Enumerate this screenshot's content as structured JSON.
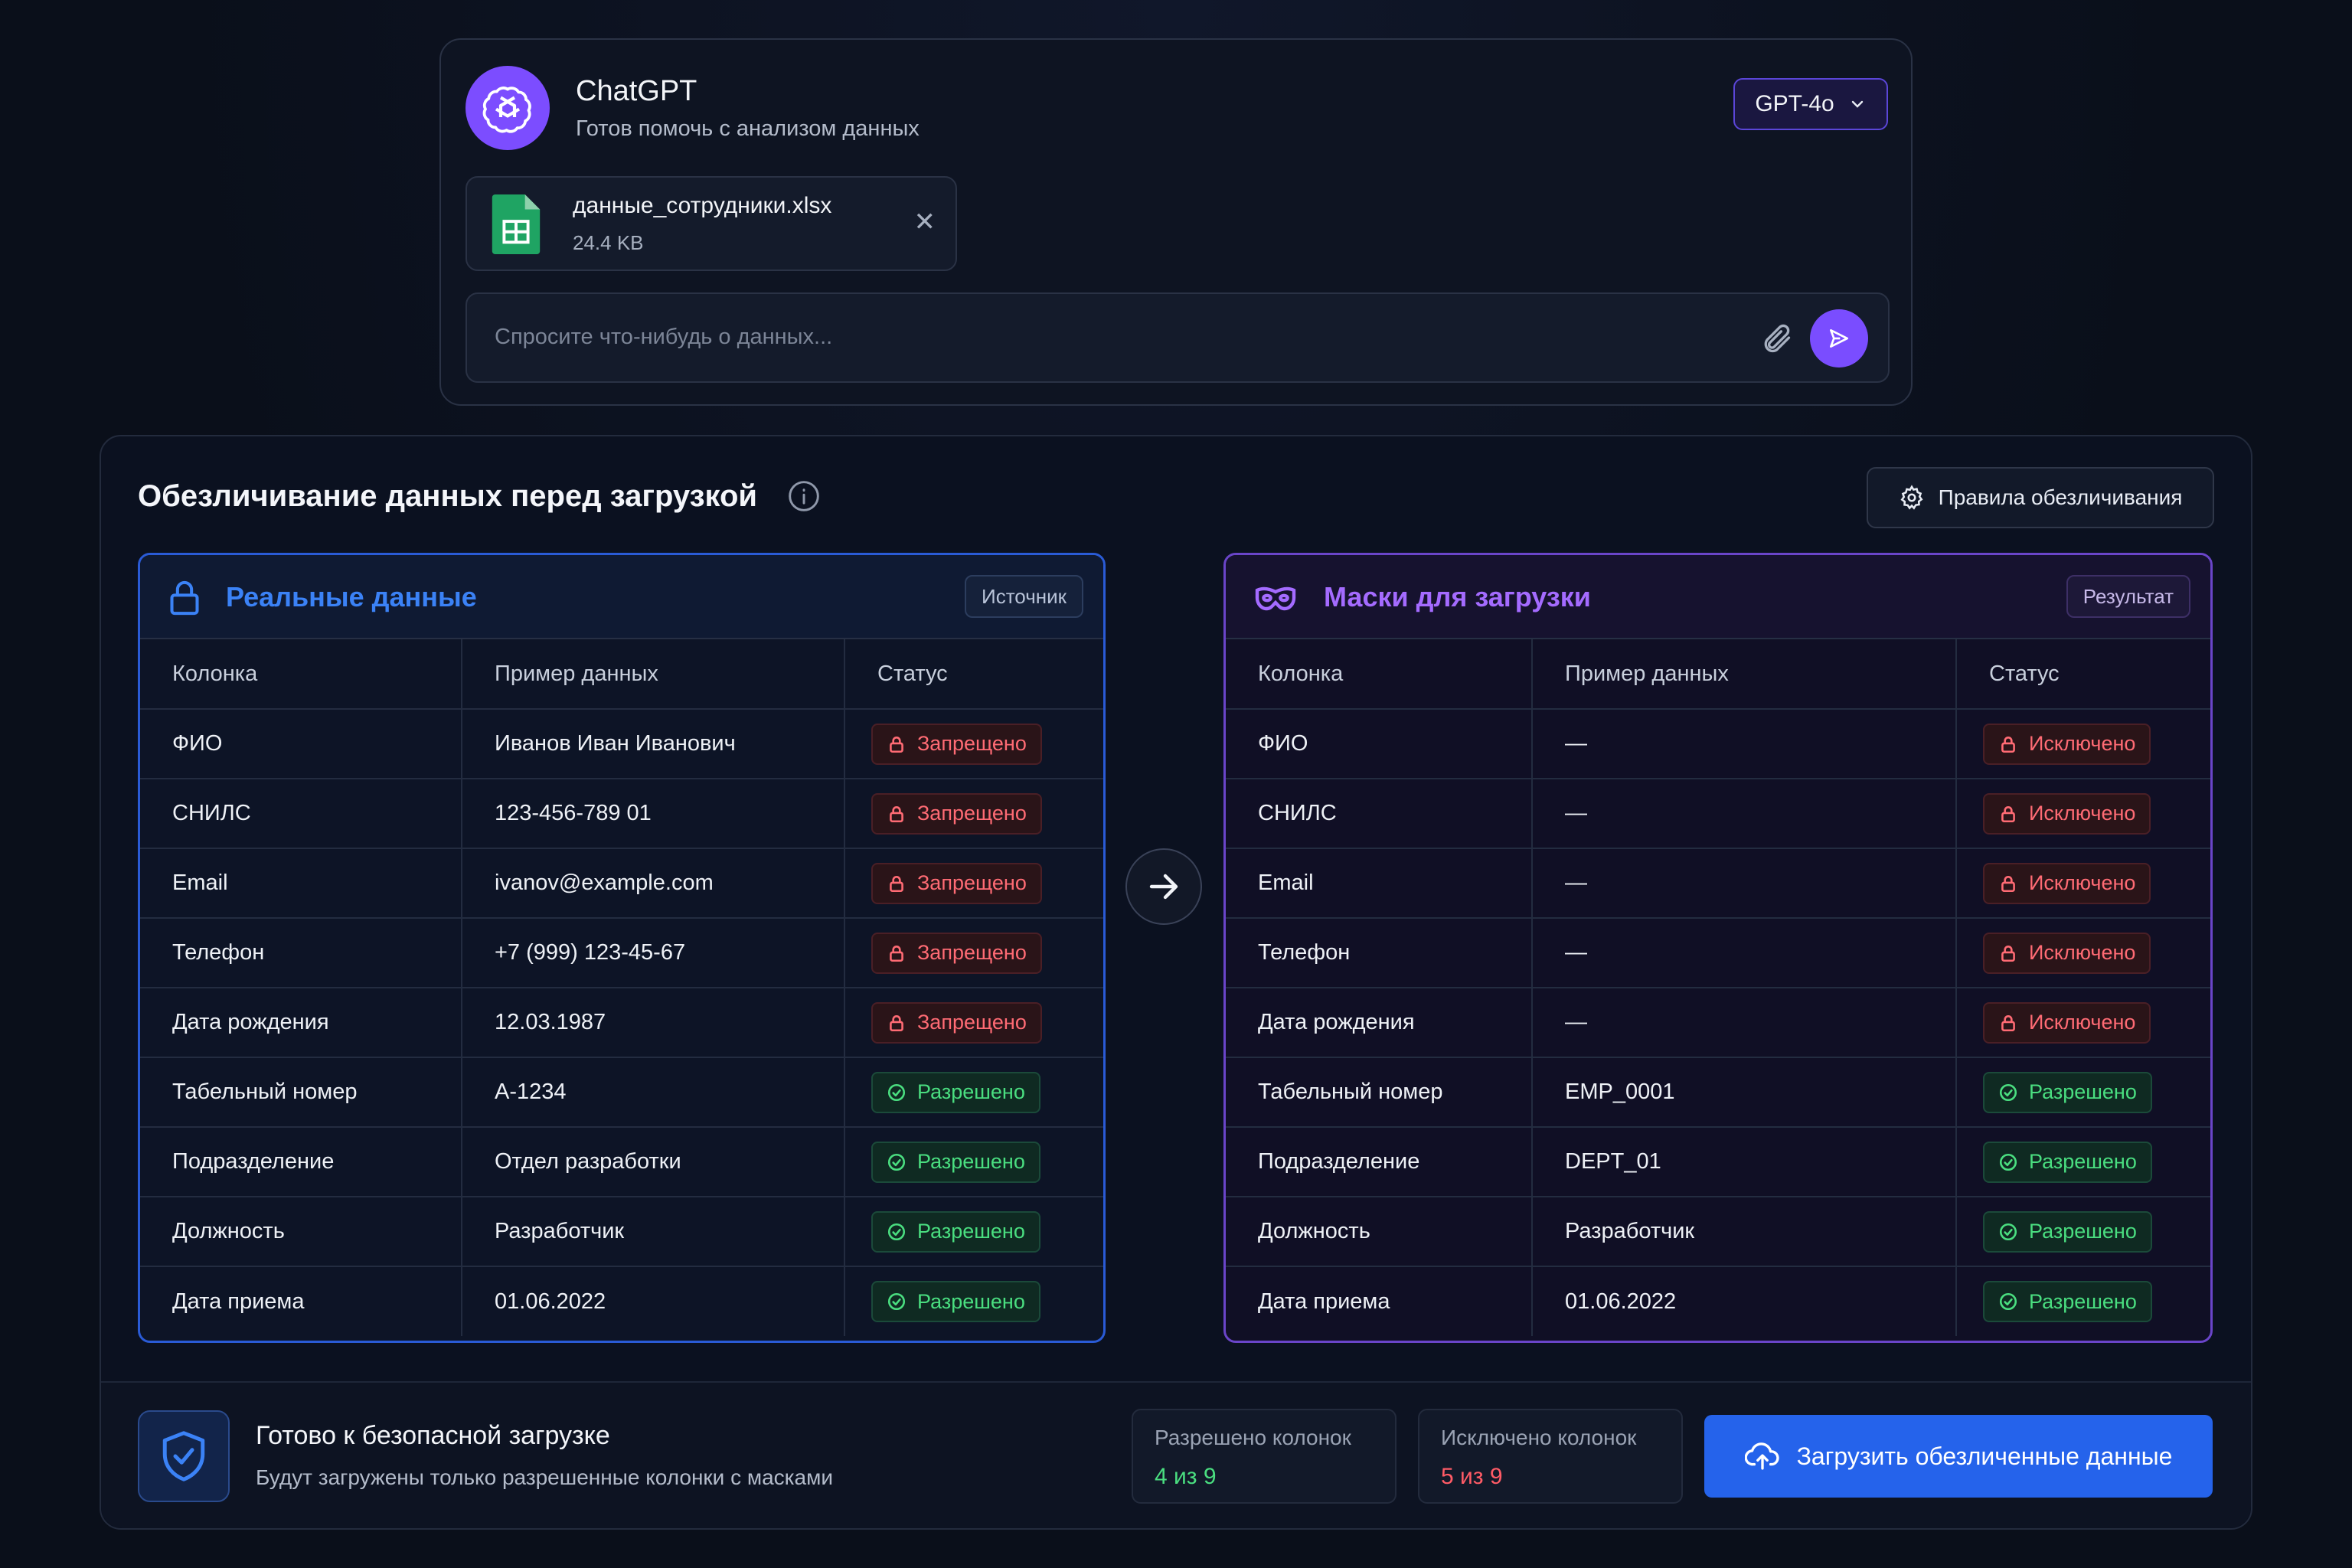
{
  "chat": {
    "title": "ChatGPT",
    "subtitle": "Готов помочь с анализом данных",
    "model": "GPT-4o",
    "file": {
      "name": "данные_сотрудники.xlsx",
      "size": "24.4 KB"
    },
    "input_placeholder": "Спросите что-нибудь о данных..."
  },
  "panel": {
    "title": "Обезличивание данных перед загрузкой",
    "rules_button": "Правила обезличивания",
    "left": {
      "title": "Реальные данные",
      "tag": "Источник",
      "headers": [
        "Колонка",
        "Пример данных",
        "Статус"
      ],
      "rows": [
        {
          "col": "ФИО",
          "sample": "Иванов Иван Иванович",
          "status": "Запрещено"
        },
        {
          "col": "СНИЛС",
          "sample": "123-456-789 01",
          "status": "Запрещено"
        },
        {
          "col": "Email",
          "sample": "ivanov@example.com",
          "status": "Запрещено"
        },
        {
          "col": "Телефон",
          "sample": "+7 (999) 123-45-67",
          "status": "Запрещено"
        },
        {
          "col": "Дата рождения",
          "sample": "12.03.1987",
          "status": "Запрещено"
        },
        {
          "col": "Табельный номер",
          "sample": "A-1234",
          "status": "Разрешено"
        },
        {
          "col": "Подразделение",
          "sample": "Отдел разработки",
          "status": "Разрешено"
        },
        {
          "col": "Должность",
          "sample": "Разработчик",
          "status": "Разрешено"
        },
        {
          "col": "Дата приема",
          "sample": "01.06.2022",
          "status": "Разрешено"
        }
      ]
    },
    "right": {
      "title": "Маски для загрузки",
      "tag": "Результат",
      "headers": [
        "Колонка",
        "Пример данных",
        "Статус"
      ],
      "rows": [
        {
          "col": "ФИО",
          "sample": "—",
          "status": "Исключено"
        },
        {
          "col": "СНИЛС",
          "sample": "—",
          "status": "Исключено"
        },
        {
          "col": "Email",
          "sample": "—",
          "status": "Исключено"
        },
        {
          "col": "Телефон",
          "sample": "—",
          "status": "Исключено"
        },
        {
          "col": "Дата рождения",
          "sample": "—",
          "status": "Исключено"
        },
        {
          "col": "Табельный номер",
          "sample": "EMP_0001",
          "status": "Разрешено"
        },
        {
          "col": "Подразделение",
          "sample": "DEPT_01",
          "status": "Разрешено"
        },
        {
          "col": "Должность",
          "sample": "Разработчик",
          "status": "Разрешено"
        },
        {
          "col": "Дата приема",
          "sample": "01.06.2022",
          "status": "Разрешено"
        }
      ]
    },
    "footer": {
      "ready_title": "Готово к безопасной загрузке",
      "ready_sub": "Будут загружены только разрешенные колонки с масками",
      "allowed_label": "Разрешено колонок",
      "allowed_value": "4 из 9",
      "excluded_label": "Исключено колонок",
      "excluded_value": "5 из 9",
      "upload_button": "Загрузить обезличенные данные"
    }
  },
  "colors": {
    "accent_blue": "#2563eb",
    "accent_purple": "#7a4dff",
    "ok": "#4ade80",
    "bad": "#ff6b74"
  },
  "icons": [
    "openai-logo-icon",
    "chevron-down-icon",
    "spreadsheet-icon",
    "close-icon",
    "paperclip-icon",
    "send-icon",
    "info-icon",
    "gear-icon",
    "lock-icon",
    "mask-icon",
    "arrow-right-icon",
    "shield-check-icon",
    "check-circle-icon",
    "cloud-upload-icon"
  ]
}
